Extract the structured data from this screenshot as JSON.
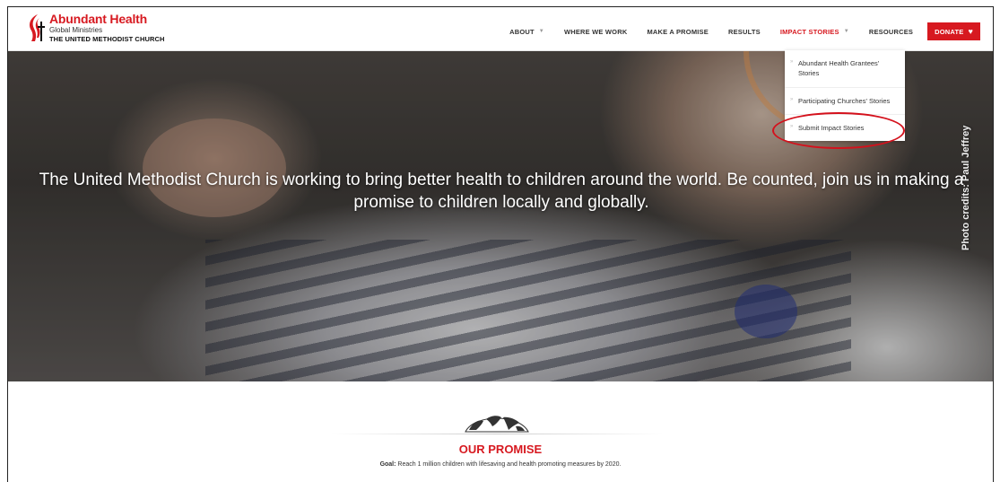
{
  "header": {
    "brand": "Abundant Health",
    "sub": "Global Ministries",
    "church": "THE UNITED METHODIST CHURCH"
  },
  "nav": {
    "about": "ABOUT",
    "where": "WHERE WE WORK",
    "promise": "MAKE A PROMISE",
    "results": "RESULTS",
    "impact": "IMPACT STORIES",
    "resources": "RESOURCES",
    "donate": "DONATE"
  },
  "dropdown": {
    "items": [
      "Abundant Health Grantees' Stories",
      "Participating Churches' Stories",
      "Submit Impact Stories"
    ]
  },
  "hero": {
    "text": "The United Methodist Church is working to bring better health to children around the world. Be counted, join us in making a promise to children locally and globally.",
    "credit": "Photo credits: Paul Jeffrey"
  },
  "promise": {
    "title": "OUR PROMISE",
    "goal_label": "Goal:",
    "goal_text": " Reach 1 million children with lifesaving and health promoting measures by 2020."
  },
  "colors": {
    "accent": "#d71920",
    "highlight": "#d4111c"
  }
}
